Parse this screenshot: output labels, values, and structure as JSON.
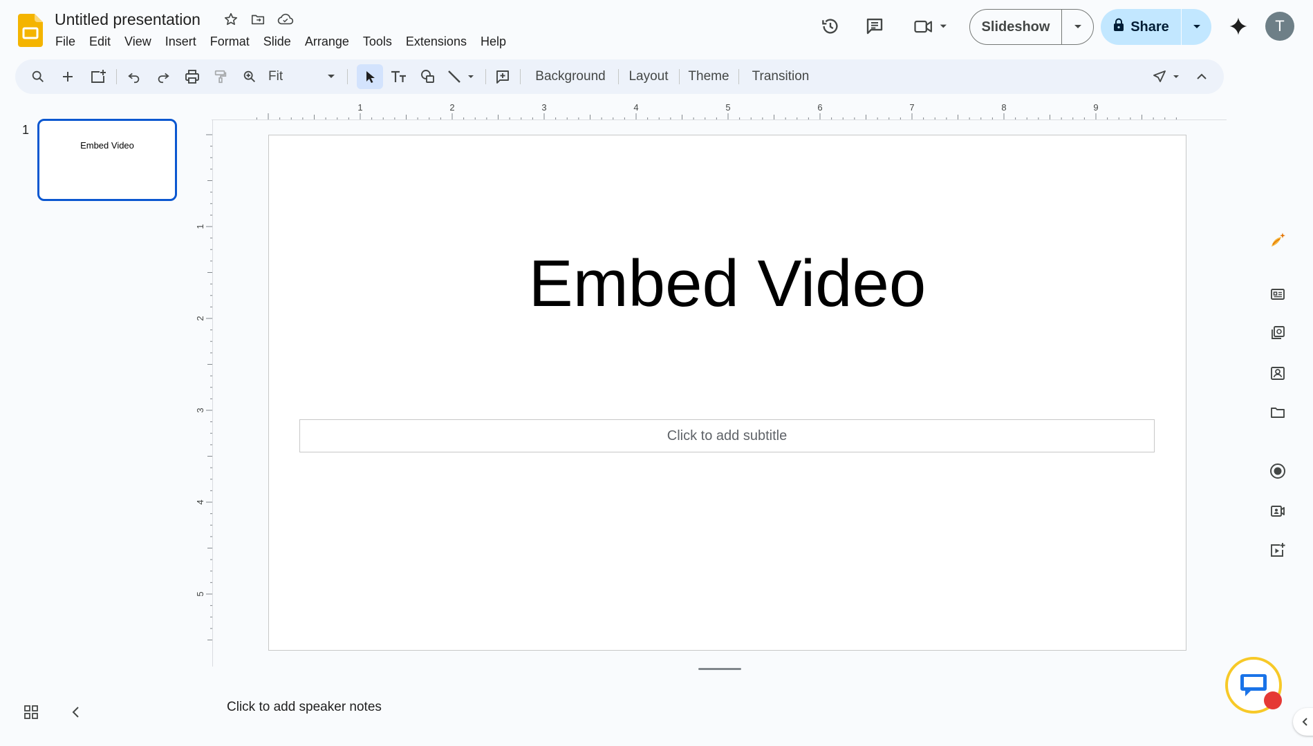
{
  "app": {
    "logo_icon": "google-slides-logo",
    "title": "Untitled presentation",
    "title_icons": [
      "star-icon",
      "move-folder-icon",
      "cloud-saved-icon"
    ]
  },
  "menu": [
    "File",
    "Edit",
    "View",
    "Insert",
    "Format",
    "Slide",
    "Arrange",
    "Tools",
    "Extensions",
    "Help"
  ],
  "header": {
    "history_icon": "version-history-icon",
    "comments_icon": "comments-icon",
    "meet_icon": "video-call-icon",
    "slideshow_label": "Slideshow",
    "share_label": "Share",
    "gemini_icon": "gemini-sparkle-icon",
    "avatar_initial": "T",
    "accent_color": "#c2e7ff"
  },
  "toolbar": {
    "zoom_label": "Fit",
    "background_label": "Background",
    "layout_label": "Layout",
    "theme_label": "Theme",
    "transition_label": "Transition"
  },
  "rulers": {
    "horizontal_labels": [
      "1",
      "2",
      "3",
      "4",
      "5",
      "6",
      "7",
      "8",
      "9"
    ],
    "vertical_labels": [
      "1",
      "2",
      "3",
      "4",
      "5"
    ]
  },
  "filmstrip": {
    "slides": [
      {
        "number": "1",
        "title": "Embed Video"
      }
    ]
  },
  "slide": {
    "title": "Embed Video",
    "subtitle_placeholder": "Click to add subtitle"
  },
  "notes": {
    "placeholder": "Click to add speaker notes"
  },
  "side_panel": {
    "icons": [
      "ai-image-icon",
      "keep-icon",
      "slides-library-icon",
      "contacts-icon",
      "folder-icon",
      "record-icon",
      "camera-icon",
      "add-video-icon"
    ]
  }
}
